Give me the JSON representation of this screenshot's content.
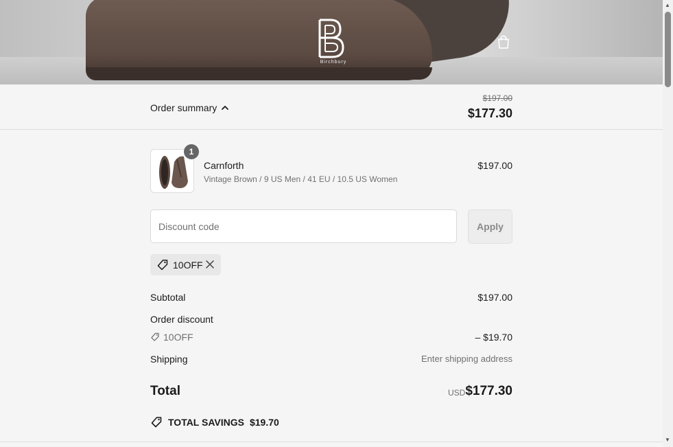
{
  "brand": {
    "logo_text": "Birchbury"
  },
  "order_summary": {
    "toggle_label": "Order summary",
    "original_total": "$197.00",
    "total": "$177.30"
  },
  "line_item": {
    "quantity": "1",
    "name": "Carnforth",
    "variant": "Vintage Brown / 9 US Men / 41 EU / 10.5 US Women",
    "price": "$197.00"
  },
  "discount": {
    "placeholder": "Discount code",
    "apply_label": "Apply",
    "applied_code": "10OFF"
  },
  "totals": {
    "subtotal_label": "Subtotal",
    "subtotal_value": "$197.00",
    "order_discount_label": "Order discount",
    "order_discount_code": "10OFF",
    "order_discount_value": "– $19.70",
    "shipping_label": "Shipping",
    "shipping_value": "Enter shipping address",
    "total_label": "Total",
    "currency": "USD",
    "total_value": "$177.30",
    "savings_label": "TOTAL SAVINGS",
    "savings_value": "$19.70"
  },
  "colors": {
    "background": "#f5f5f5",
    "text": "#1a1a1a",
    "muted": "#707070",
    "apply_bg": "#ededed"
  },
  "icons": {
    "cart": "shopping-bag-icon",
    "toggle": "chevron-up-icon",
    "tag": "tag-icon",
    "remove": "close-icon"
  }
}
